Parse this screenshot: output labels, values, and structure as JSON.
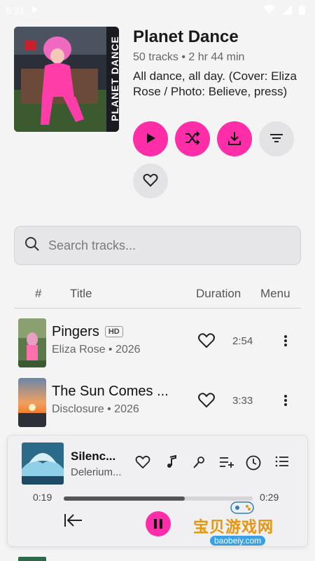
{
  "status": {
    "time": "5:31"
  },
  "playlist": {
    "title": "Planet Dance",
    "meta": "50 tracks • 2 hr 44 min",
    "description": "All dance, all day. (Cover: Eliza Rose / Photo: Believe, press)",
    "cover_text": "PLANET DANCE"
  },
  "actions": [
    {
      "name": "play-icon",
      "color": "pink"
    },
    {
      "name": "shuffle-icon",
      "color": "pink"
    },
    {
      "name": "download-icon",
      "color": "pink"
    },
    {
      "name": "filter-icon",
      "color": "grey"
    },
    {
      "name": "heart-icon",
      "color": "grey"
    }
  ],
  "search": {
    "placeholder": "Search tracks..."
  },
  "table": {
    "headers": {
      "number": "#",
      "title": "Title",
      "duration": "Duration",
      "menu": "Menu"
    },
    "rows": [
      {
        "title": "Pingers",
        "badge": "HD",
        "subtitle": "Eliza Rose • 2026",
        "duration": "2:54"
      },
      {
        "title": "The Sun Comes ...",
        "badge": "",
        "subtitle": "Disclosure • 2026",
        "duration": "3:33"
      }
    ]
  },
  "player": {
    "title": "Silenc...",
    "artist": "Delerium...",
    "elapsed": "0:19",
    "remaining": "0:29",
    "progress": 0.64
  },
  "watermark": {
    "text": "宝贝游戏网",
    "url": "baobeiy.com"
  },
  "colors": {
    "accent": "#ff2da8",
    "background": "#f4f4f5"
  }
}
